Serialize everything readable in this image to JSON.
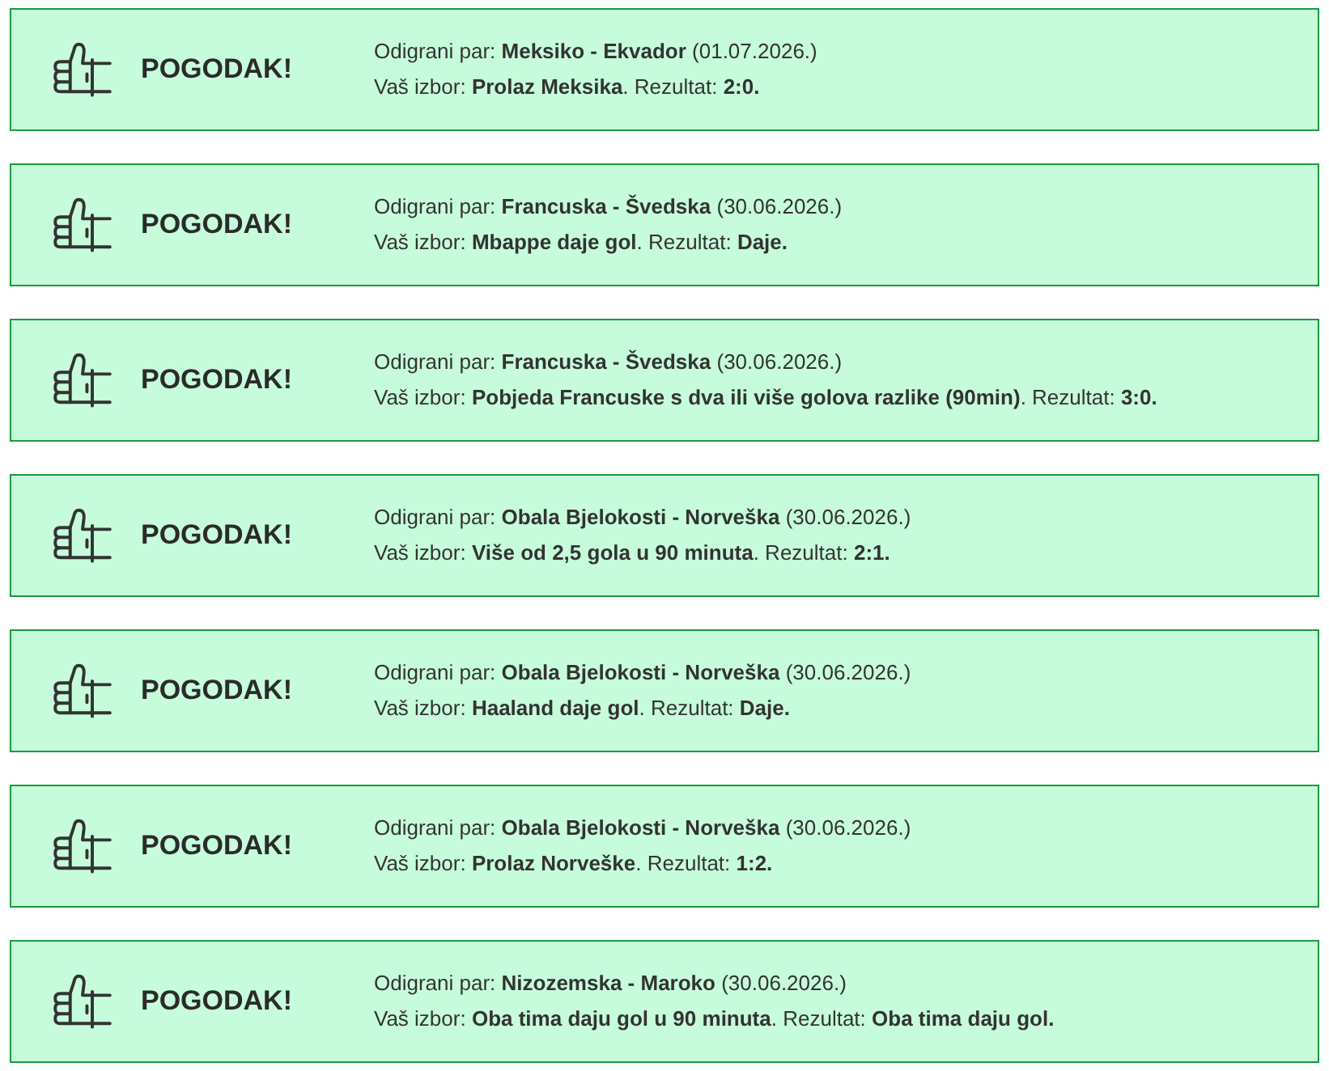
{
  "results": [
    {
      "status": {
        "kind": "hit",
        "label": "POGODAK!"
      },
      "match": "Odigrani par: **Meksiko - Ekvador** (01.07.2026.)",
      "pick": "Vaš izbor: **Prolaz Meksika**. Rezultat: **2:0.**"
    },
    {
      "status": {
        "kind": "hit",
        "label": "POGODAK!"
      },
      "match": "Odigrani par: **Francuska - Švedska** (30.06.2026.)",
      "pick": "Vaš izbor: **Mbappe daje gol**. Rezultat: **Daje.**"
    },
    {
      "status": {
        "kind": "hit",
        "label": "POGODAK!"
      },
      "match": "Odigrani par: **Francuska - Švedska** (30.06.2026.)",
      "pick": "Vaš izbor: **Pobjeda Francuske s dva ili više golova razlike (90min)**. Rezultat: **3:0.**"
    },
    {
      "status": {
        "kind": "hit",
        "label": "POGODAK!"
      },
      "match": "Odigrani par: **Obala Bjelokosti - Norveška** (30.06.2026.)",
      "pick": "Vaš izbor: **Više od 2,5 gola u 90 minuta**. Rezultat: **2:1.**"
    },
    {
      "status": {
        "kind": "hit",
        "label": "POGODAK!"
      },
      "match": "Odigrani par: **Obala Bjelokosti - Norveška** (30.06.2026.)",
      "pick": "Vaš izbor: **Haaland daje gol**. Rezultat: **Daje.**"
    },
    {
      "status": {
        "kind": "hit",
        "label": "POGODAK!"
      },
      "match": "Odigrani par: **Obala Bjelokosti - Norveška** (30.06.2026.)",
      "pick": "Vaš izbor: **Prolaz Norveške**. Rezultat: **1:2.**"
    },
    {
      "status": {
        "kind": "hit",
        "label": "POGODAK!"
      },
      "match": "Odigrani par: **Nizozemska - Maroko** (30.06.2026.)",
      "pick": "Vaš izbor: **Oba tima daju gol u 90 minuta**. Rezultat: **Oba tima daju gol.**"
    }
  ]
}
